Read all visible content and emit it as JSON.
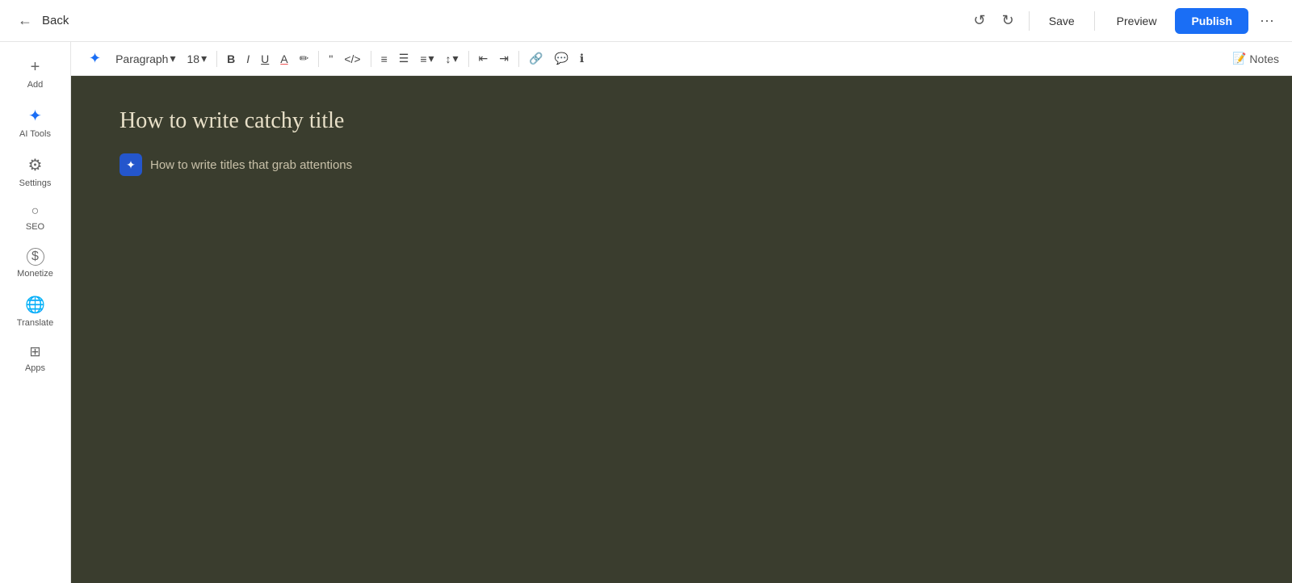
{
  "header": {
    "back_label": "Back",
    "save_label": "Save",
    "preview_label": "Preview",
    "publish_label": "Publish"
  },
  "sidebar": {
    "items": [
      {
        "id": "add",
        "icon": "+",
        "label": "Add"
      },
      {
        "id": "ai-tools",
        "icon": "✦",
        "label": "AI Tools"
      },
      {
        "id": "settings",
        "icon": "⚙",
        "label": "Settings"
      },
      {
        "id": "seo",
        "icon": "🔍",
        "label": "SEO"
      },
      {
        "id": "monetize",
        "icon": "$",
        "label": "Monetize"
      },
      {
        "id": "translate",
        "icon": "🌐",
        "label": "Translate"
      },
      {
        "id": "apps",
        "icon": "⊞",
        "label": "Apps"
      }
    ]
  },
  "toolbar": {
    "ai_icon": "✦",
    "paragraph_label": "Paragraph",
    "font_size": "18",
    "bold_label": "B",
    "italic_label": "I",
    "underline_label": "U",
    "font_color_label": "A",
    "highlight_label": "✏",
    "quote_label": "❝",
    "code_label": "</>",
    "ordered_list_label": "≡",
    "unordered_list_label": "•≡",
    "align_label": "≡",
    "line_spacing_label": "↕",
    "indent_decrease_label": "⇤",
    "indent_increase_label": "⇥",
    "link_label": "🔗",
    "comment_label": "💬",
    "info_label": "ℹ",
    "notes_label": "Notes"
  },
  "editor": {
    "title": "How to write catchy title",
    "ai_suggestion": "How to write titles that grab attentions"
  }
}
